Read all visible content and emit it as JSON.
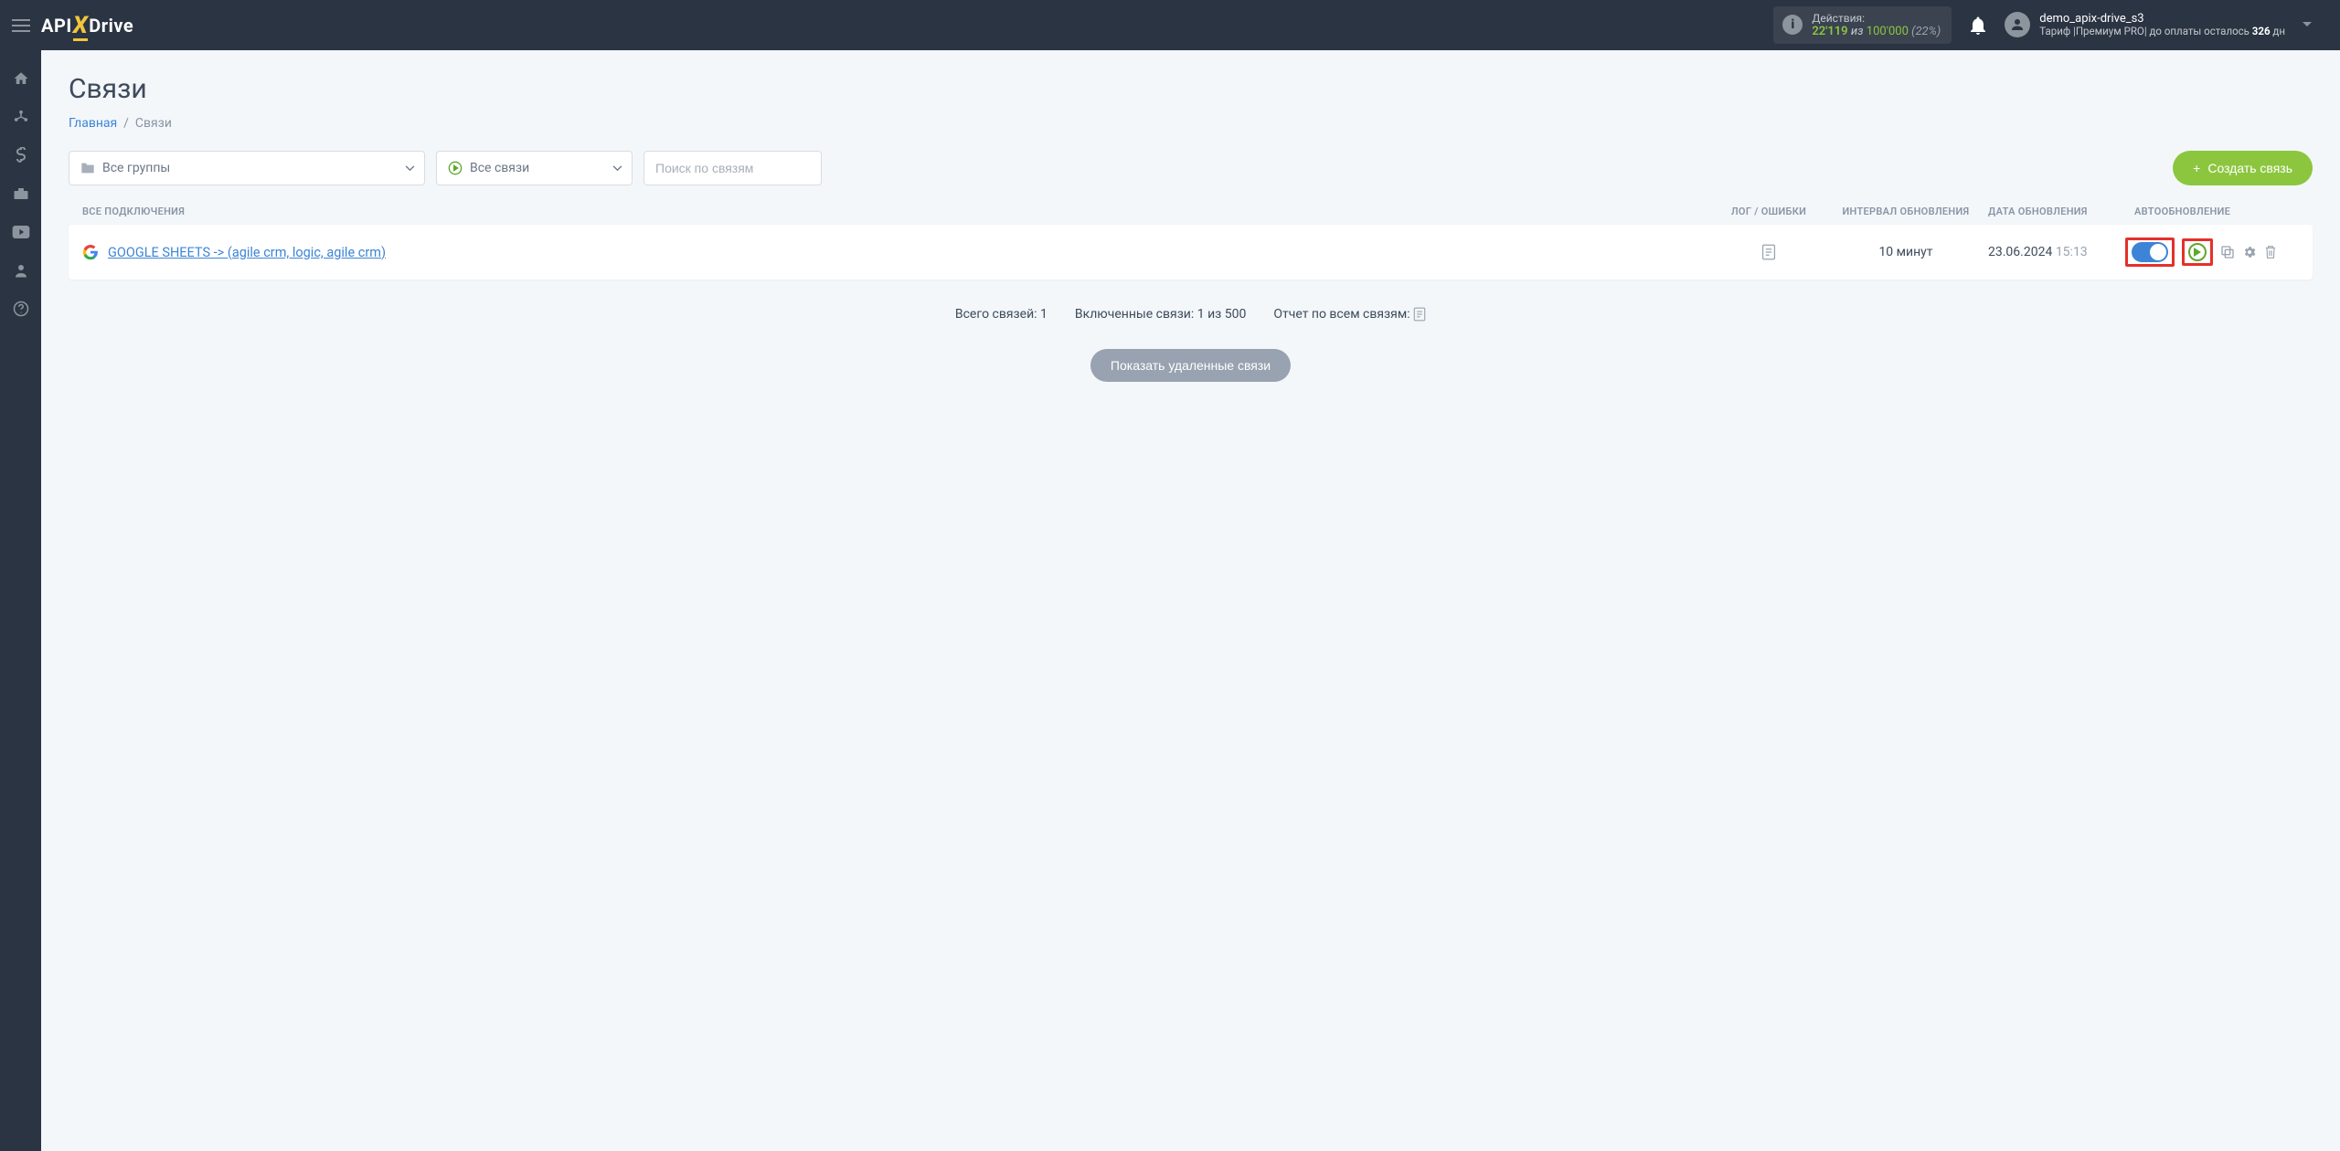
{
  "header": {
    "logo_api": "API",
    "logo_drive": "Drive",
    "actions_label": "Действия:",
    "actions_used": "22'119",
    "actions_iz": "из",
    "actions_total": "100'000",
    "actions_pct": "(22%)",
    "user_email": "demo_apix-drive_s3",
    "tariff_prefix": "Тариф |Премиум PRO| до оплаты осталось ",
    "tariff_days": "326",
    "tariff_suffix": " дн"
  },
  "page": {
    "title": "Связи",
    "bc_home": "Главная",
    "bc_current": "Связи"
  },
  "filters": {
    "groups": "Все группы",
    "status": "Все связи",
    "search_placeholder": "Поиск по связям",
    "create": "Создать связь"
  },
  "columns": {
    "name": "ВСЕ ПОДКЛЮЧЕНИЯ",
    "log": "ЛОГ / ОШИБКИ",
    "interval": "ИНТЕРВАЛ ОБНОВЛЕНИЯ",
    "date": "ДАТА ОБНОВЛЕНИЯ",
    "auto": "АВТООБНОВЛЕНИЕ"
  },
  "row": {
    "name": "GOOGLE SHEETS -> (agile crm, logic, agile crm)",
    "interval": "10 минут",
    "date": "23.06.2024",
    "time": "15:13"
  },
  "summary": {
    "total": "Всего связей: 1",
    "enabled": "Включенные связи: 1 из 500",
    "report": "Отчет по всем связям:"
  },
  "btn": {
    "show_deleted": "Показать удаленные связи"
  }
}
